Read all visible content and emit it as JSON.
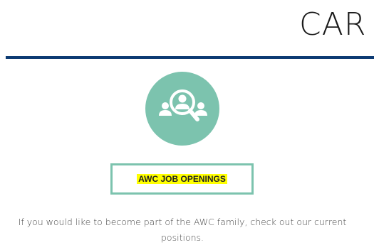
{
  "header": {
    "title": "CAR"
  },
  "colors": {
    "rule": "#0d3b73",
    "accent": "#7cc3ae",
    "highlight": "#ffff00",
    "icon_white": "#ffffff"
  },
  "feature": {
    "icon": "job-search-people-icon",
    "button_label": "AWC JOB OPENINGS",
    "description": "If you would like to become part of the AWC family, check out our current positions."
  }
}
